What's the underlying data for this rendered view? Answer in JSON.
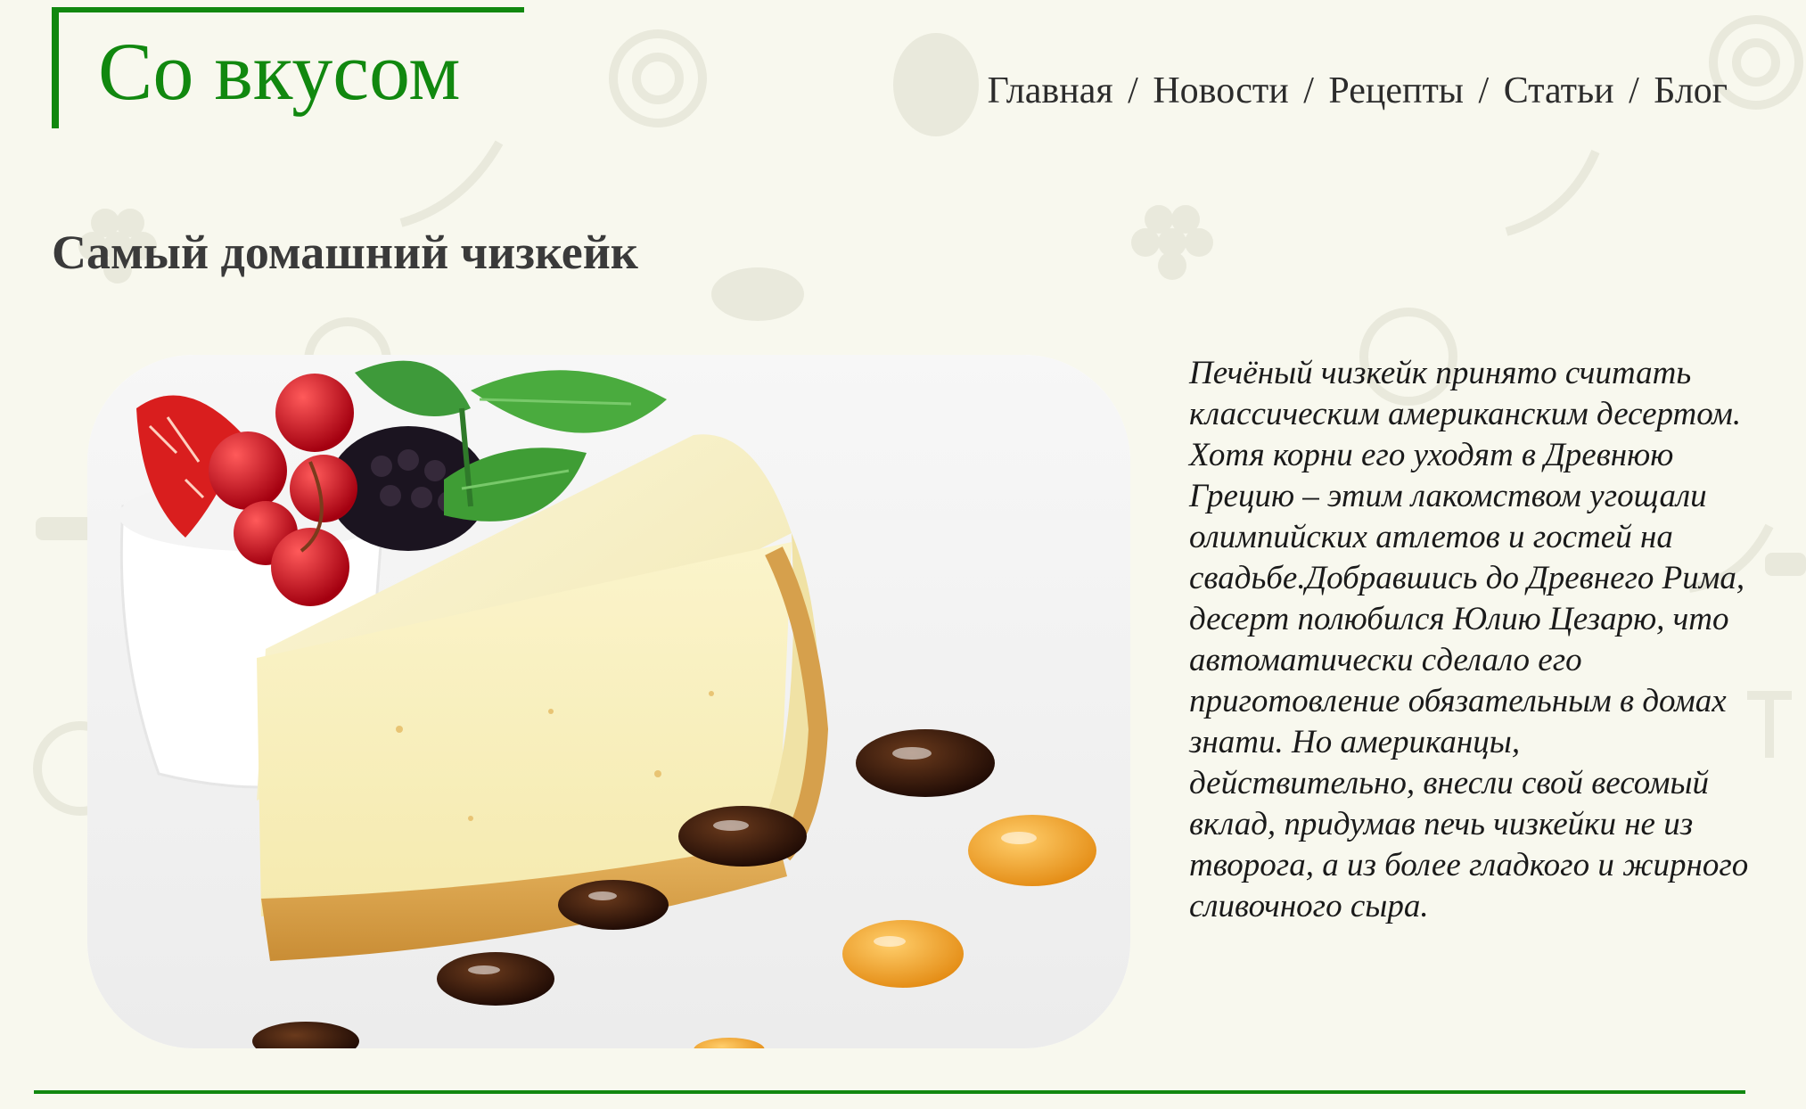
{
  "site": {
    "logo_text": "Со вкусом",
    "brand_color": "#11880f",
    "background_color": "#f8f8ee"
  },
  "nav": {
    "items": [
      {
        "label": "Главная"
      },
      {
        "label": "Новости"
      },
      {
        "label": "Рецепты"
      },
      {
        "label": "Статьи"
      },
      {
        "label": "Блог"
      }
    ],
    "separator": "/"
  },
  "article": {
    "title": "Самый домашний чизкейк",
    "image_icon": "cheesecake-photo",
    "body": "Печёный чизкейк принято считать классическим американским десертом. Хотя корни его уходят в Древнюю Грецию – этим лакомством угощали олимпийских атлетов и гостей на свадьбе.Добравшись до Древнего Рима, десерт полюбился Юлию Цезарю, что автоматически сделало его приготовление обязательным в домах знати. Но американцы, действительно, внесли свой весомый вклад, придумав печь чизкейки не из творога, а из более гладкого и жирного сливочного сыра."
  }
}
